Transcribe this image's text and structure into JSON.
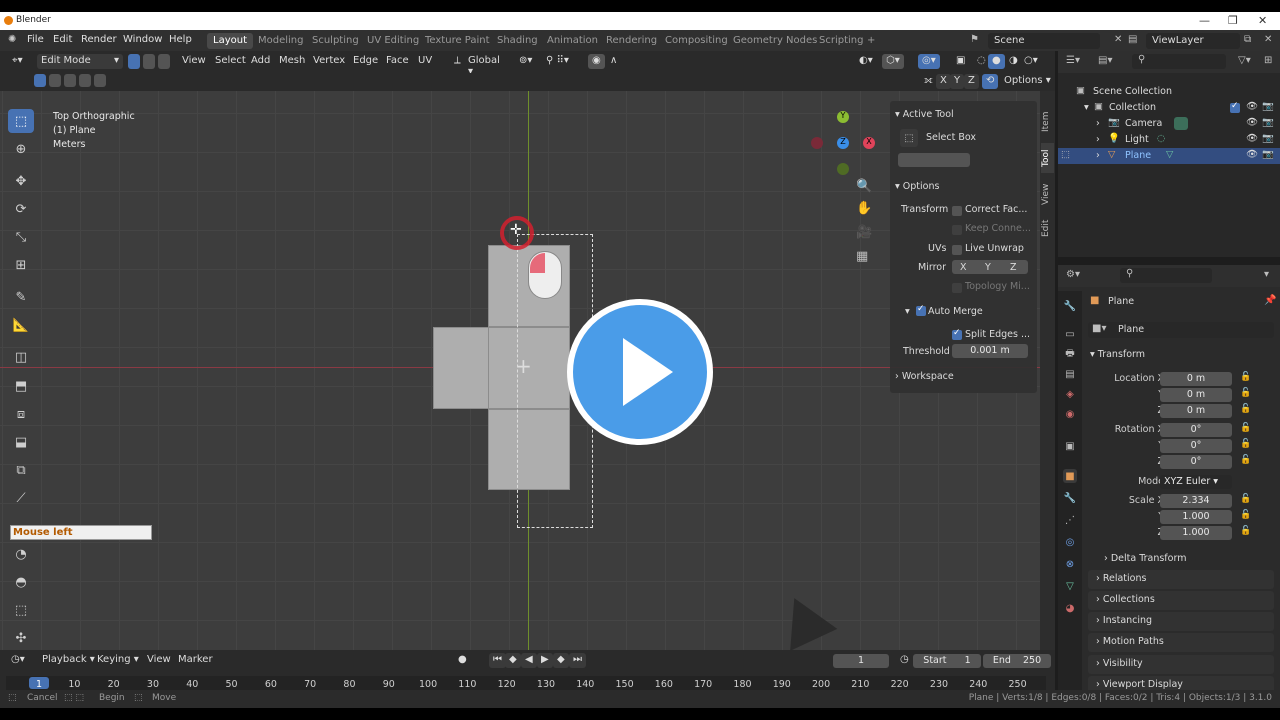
{
  "app": {
    "title": "Blender"
  },
  "menus": [
    "File",
    "Edit",
    "Render",
    "Window",
    "Help"
  ],
  "workspaces": [
    "Layout",
    "Modeling",
    "Sculpting",
    "UV Editing",
    "Texture Paint",
    "Shading",
    "Animation",
    "Rendering",
    "Compositing",
    "Geometry Nodes",
    "Scripting"
  ],
  "workspace_add": "+",
  "scene": {
    "name": "Scene",
    "view_layer": "ViewLayer"
  },
  "viewport_header": {
    "mode": "Edit Mode",
    "menus": [
      "View",
      "Select",
      "Add",
      "Mesh",
      "Vertex",
      "Edge",
      "Face",
      "UV"
    ],
    "orientation": "Global",
    "axes": [
      "X",
      "Y",
      "Z"
    ],
    "options": "Options"
  },
  "overlay": {
    "view_name": "Top Orthographic",
    "object": "(1) Plane",
    "units": "Meters"
  },
  "mouse_hint": "Mouse left",
  "gizmo": {
    "x": "X",
    "y": "Y",
    "z": "Z"
  },
  "npanel": {
    "tabs": [
      "Item",
      "Tool",
      "View",
      "Edit"
    ],
    "active_tool_header": "Active Tool",
    "active_tool": "Select Box",
    "options_header": "Options",
    "transform_label": "Transform",
    "correct_face": "Correct Fac...",
    "keep_connected": "Keep Conne...",
    "uvs_label": "UVs",
    "live_unwrap": "Live Unwrap",
    "mirror_label": "Mirror",
    "mirror_axes": [
      "X",
      "Y",
      "Z"
    ],
    "topology_mirror": "Topology Mi...",
    "auto_merge": "Auto Merge",
    "split_edges": "Split Edges ...",
    "threshold_label": "Threshold",
    "threshold_value": "0.001 m",
    "workspace_header": "Workspace"
  },
  "outliner": {
    "items": [
      {
        "label": "Scene Collection",
        "indent": 0
      },
      {
        "label": "Collection",
        "indent": 1
      },
      {
        "label": "Camera",
        "indent": 2
      },
      {
        "label": "Light",
        "indent": 2
      },
      {
        "label": "Plane",
        "indent": 2,
        "selected": true
      }
    ]
  },
  "properties": {
    "object_name": "Plane",
    "data_name": "Plane",
    "transform_header": "Transform",
    "location_label": "Location X",
    "location": [
      "0 m",
      "0 m",
      "0 m"
    ],
    "rotation_label": "Rotation X",
    "rotation": [
      "0°",
      "0°",
      "0°"
    ],
    "mode_label": "Mode",
    "mode_value": "XYZ Euler",
    "scale_label": "Scale X",
    "scale": [
      "2.334",
      "1.000",
      "1.000"
    ],
    "axis_y": "Y",
    "axis_z": "Z",
    "delta_transform": "Delta Transform",
    "sections": [
      "Relations",
      "Collections",
      "Instancing",
      "Motion Paths",
      "Visibility",
      "Viewport Display"
    ]
  },
  "timeline": {
    "menus": [
      "Playback",
      "Keying",
      "View",
      "Marker"
    ],
    "current_frame": "1",
    "start_label": "Start",
    "start": "1",
    "end_label": "End",
    "end": "250",
    "ticks": [
      "1",
      "10",
      "20",
      "30",
      "40",
      "50",
      "60",
      "70",
      "80",
      "90",
      "100",
      "110",
      "120",
      "130",
      "140",
      "150",
      "160",
      "170",
      "180",
      "190",
      "200",
      "210",
      "220",
      "230",
      "240",
      "250"
    ]
  },
  "statusbar": {
    "left": [
      "Cancel",
      "Begin",
      "Move"
    ],
    "right": "Plane | Verts:1/8 | Edges:0/8 | Faces:0/2 | Tris:4 | Objects:1/3 | 3.1.0"
  },
  "colors": {
    "accent": "#4772b3",
    "play_button": "#4a9ce8",
    "x_axis": "#e0435a",
    "y_axis": "#8cbd32",
    "z_axis": "#3a8ee8"
  }
}
